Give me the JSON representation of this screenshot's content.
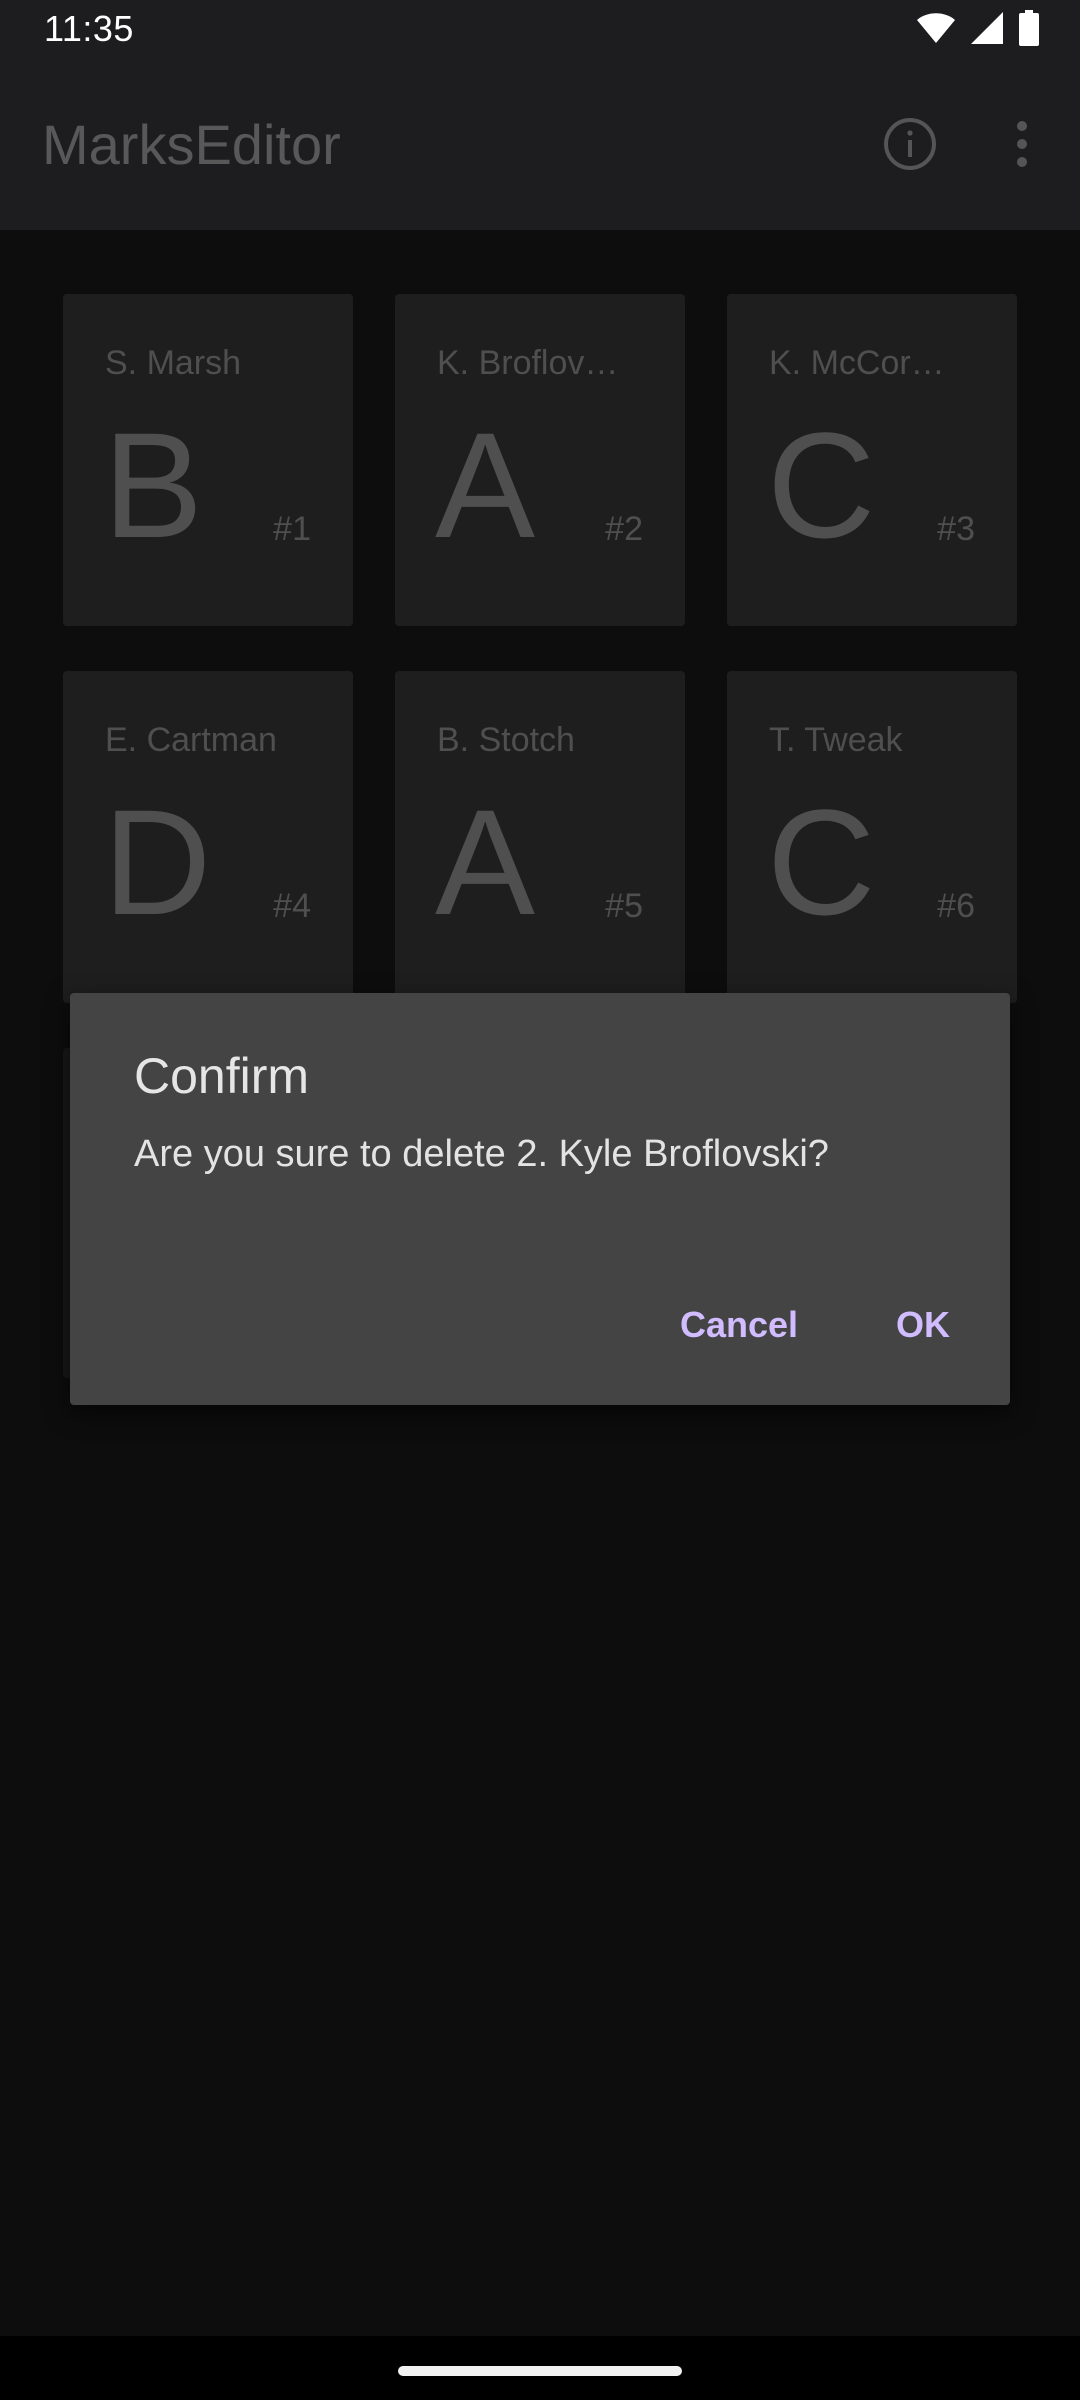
{
  "status_bar": {
    "time": "11:35",
    "icons": [
      "wifi-icon",
      "signal-icon",
      "battery-icon"
    ]
  },
  "app_bar": {
    "title": "MarksEditor",
    "actions": [
      "info-icon",
      "more-vert-icon"
    ]
  },
  "students": [
    {
      "name": "S. Marsh",
      "grade": "B",
      "number": "#1"
    },
    {
      "name": "K. Broflov…",
      "grade": "A",
      "number": "#2"
    },
    {
      "name": "K. McCor…",
      "grade": "C",
      "number": "#3"
    },
    {
      "name": "E. Cartman",
      "grade": "D",
      "number": "#4"
    },
    {
      "name": "B. Stotch",
      "grade": "A",
      "number": "#5"
    },
    {
      "name": "T. Tweak",
      "grade": "C",
      "number": "#6"
    }
  ],
  "dialog": {
    "title": "Confirm",
    "message": "Are you sure to delete 2. Kyle Broflovski?",
    "cancel_label": "Cancel",
    "ok_label": "OK"
  },
  "colors": {
    "accent": "#d0bcff",
    "dialog_bg": "#444444",
    "card_bg": "#1e1e1e",
    "app_bar_bg": "#1d1d20"
  }
}
